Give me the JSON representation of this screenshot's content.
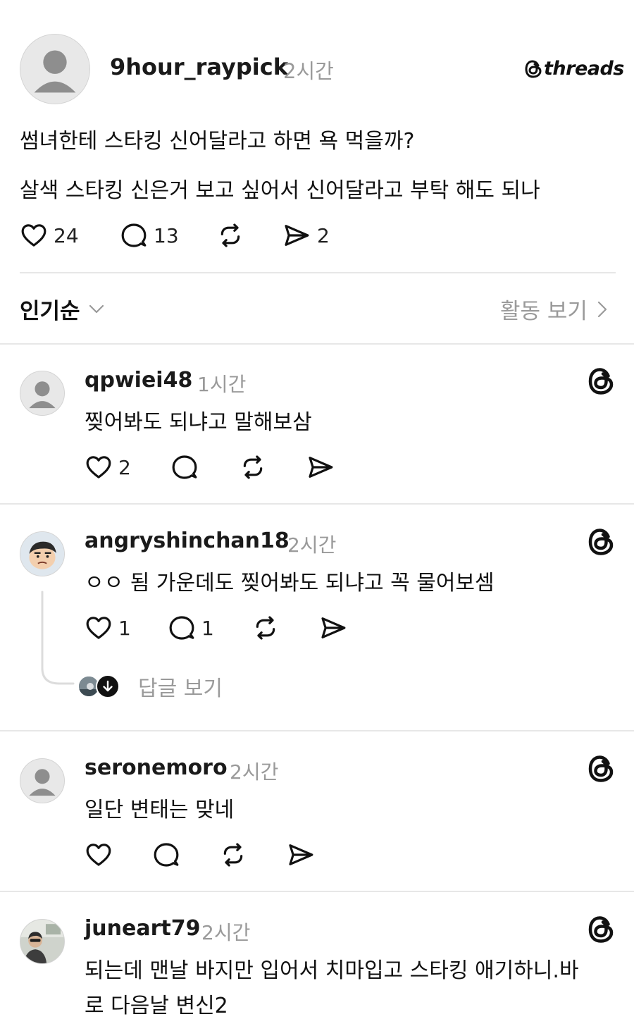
{
  "post": {
    "username": "9hour_raypick",
    "time": "2시간",
    "brand": "threads",
    "lines": [
      "썸녀한테 스타킹 신어달라고 하면 욕 먹을까?",
      "살색 스타킹 신은거 보고 싶어서 신어달라고 부탁 해도 되나"
    ],
    "likes": "24",
    "comments": "13",
    "shares": "2"
  },
  "sort": {
    "label": "인기순",
    "activity_label": "활동 보기"
  },
  "replies": [
    {
      "username": "qpwiei48",
      "time": "1시간",
      "text": "찢어봐도 되냐고 말해보삼",
      "likes": "2"
    },
    {
      "username": "angryshinchan18",
      "time": "2시간",
      "text": "ㅇㅇ 됨 가운데도 찢어봐도 되냐고 꼭 물어보셈",
      "likes": "1",
      "comments": "1",
      "view_replies": "답글 보기"
    },
    {
      "username": "seronemoro",
      "time": "2시간",
      "text": "일단 변태는 맞네"
    },
    {
      "username": "juneart79",
      "time": "2시간",
      "text_line1": "되는데 맨날 바지만 입어서 치마입고 스타킹 애기하니.바",
      "text_line2": "로 다음날 변신2"
    }
  ]
}
